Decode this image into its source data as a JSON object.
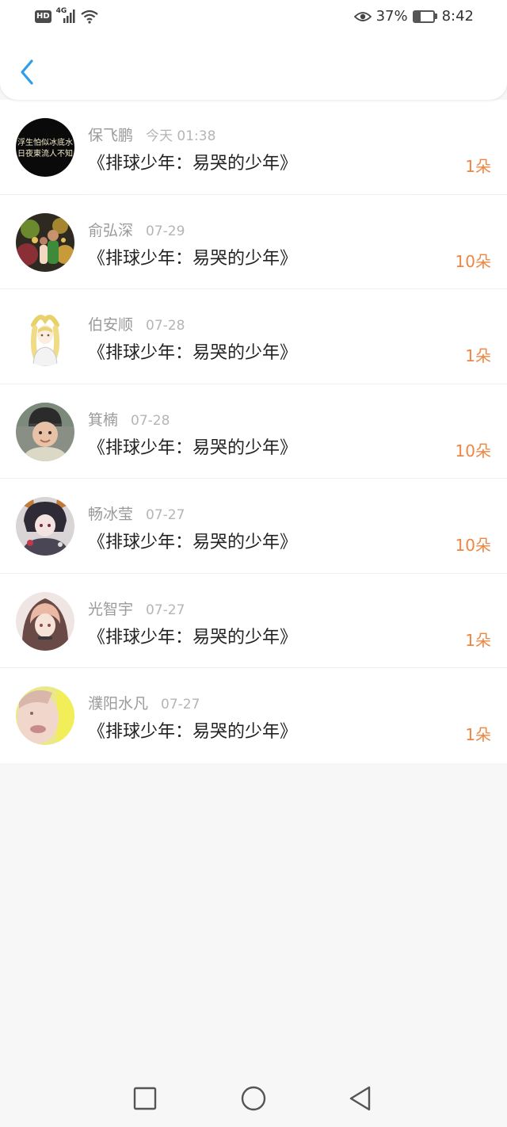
{
  "status_bar": {
    "hd_badge": "HD",
    "network": "4G",
    "battery_percent": "37%",
    "battery_level": 0.37,
    "time": "8:42"
  },
  "header": {
    "back_icon": "chevron-left-icon",
    "accent_color": "#2f9ee8"
  },
  "records": [
    {
      "name": "保飞鹏",
      "date": "今天 01:38",
      "title": "《排球少年：易哭的少年》",
      "count": "1朵",
      "avatar": "text-avatar"
    },
    {
      "name": "俞弘深",
      "date": "07-29",
      "title": "《排球少年：易哭的少年》",
      "count": "10朵",
      "avatar": "photo-avatar"
    },
    {
      "name": "伯安顺",
      "date": "07-28",
      "title": "《排球少年：易哭的少年》",
      "count": "1朵",
      "avatar": "anime-avatar"
    },
    {
      "name": "箕楠",
      "date": "07-28",
      "title": "《排球少年：易哭的少年》",
      "count": "10朵",
      "avatar": "child-avatar"
    },
    {
      "name": "畅冰莹",
      "date": "07-27",
      "title": "《排球少年：易哭的少年》",
      "count": "10朵",
      "avatar": "anime-avatar"
    },
    {
      "name": "光智宇",
      "date": "07-27",
      "title": "《排球少年：易哭的少年》",
      "count": "1朵",
      "avatar": "anime-avatar"
    },
    {
      "name": "濮阳水凡",
      "date": "07-27",
      "title": "《排球少年：易哭的少年》",
      "count": "1朵",
      "avatar": "photo-avatar"
    }
  ],
  "avatar_logo_text": [
    "浮生怕似冰底水",
    "日夜東流人不知"
  ],
  "count_color": "#ee8642",
  "nav_bar": {
    "recents_icon": "square-icon",
    "home_icon": "circle-icon",
    "back_icon": "triangle-back-icon"
  }
}
